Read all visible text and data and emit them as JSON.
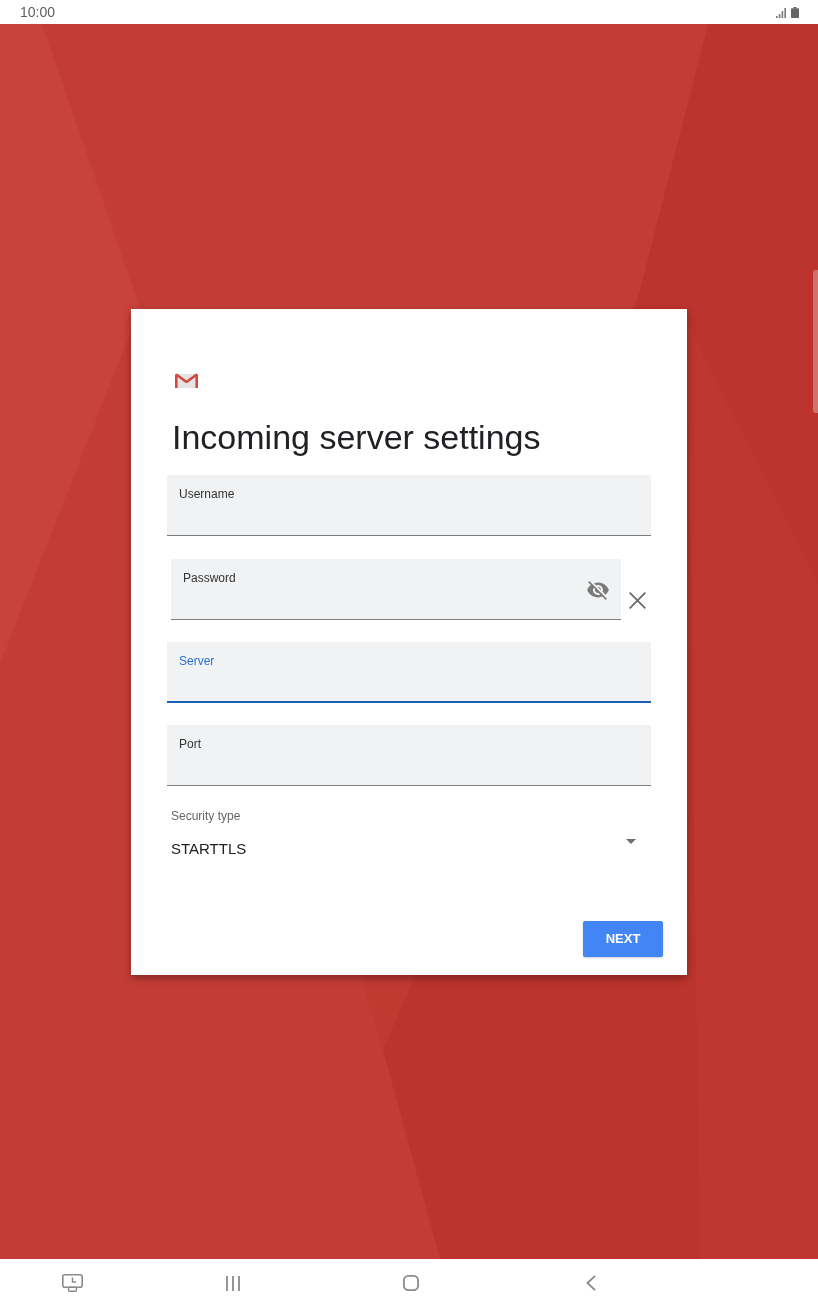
{
  "status_bar": {
    "time": "10:00"
  },
  "dialog": {
    "title": "Incoming server settings",
    "fields": [
      {
        "kind": "text",
        "label": "Username",
        "focused": false
      },
      {
        "kind": "password",
        "label": "Password",
        "focused": false
      },
      {
        "kind": "text",
        "label": "Server",
        "focused": true
      },
      {
        "kind": "text",
        "label": "Port",
        "focused": false
      }
    ],
    "security": {
      "label": "Security type",
      "value": "STARTTLS"
    },
    "button": {
      "label": "NEXT"
    }
  }
}
